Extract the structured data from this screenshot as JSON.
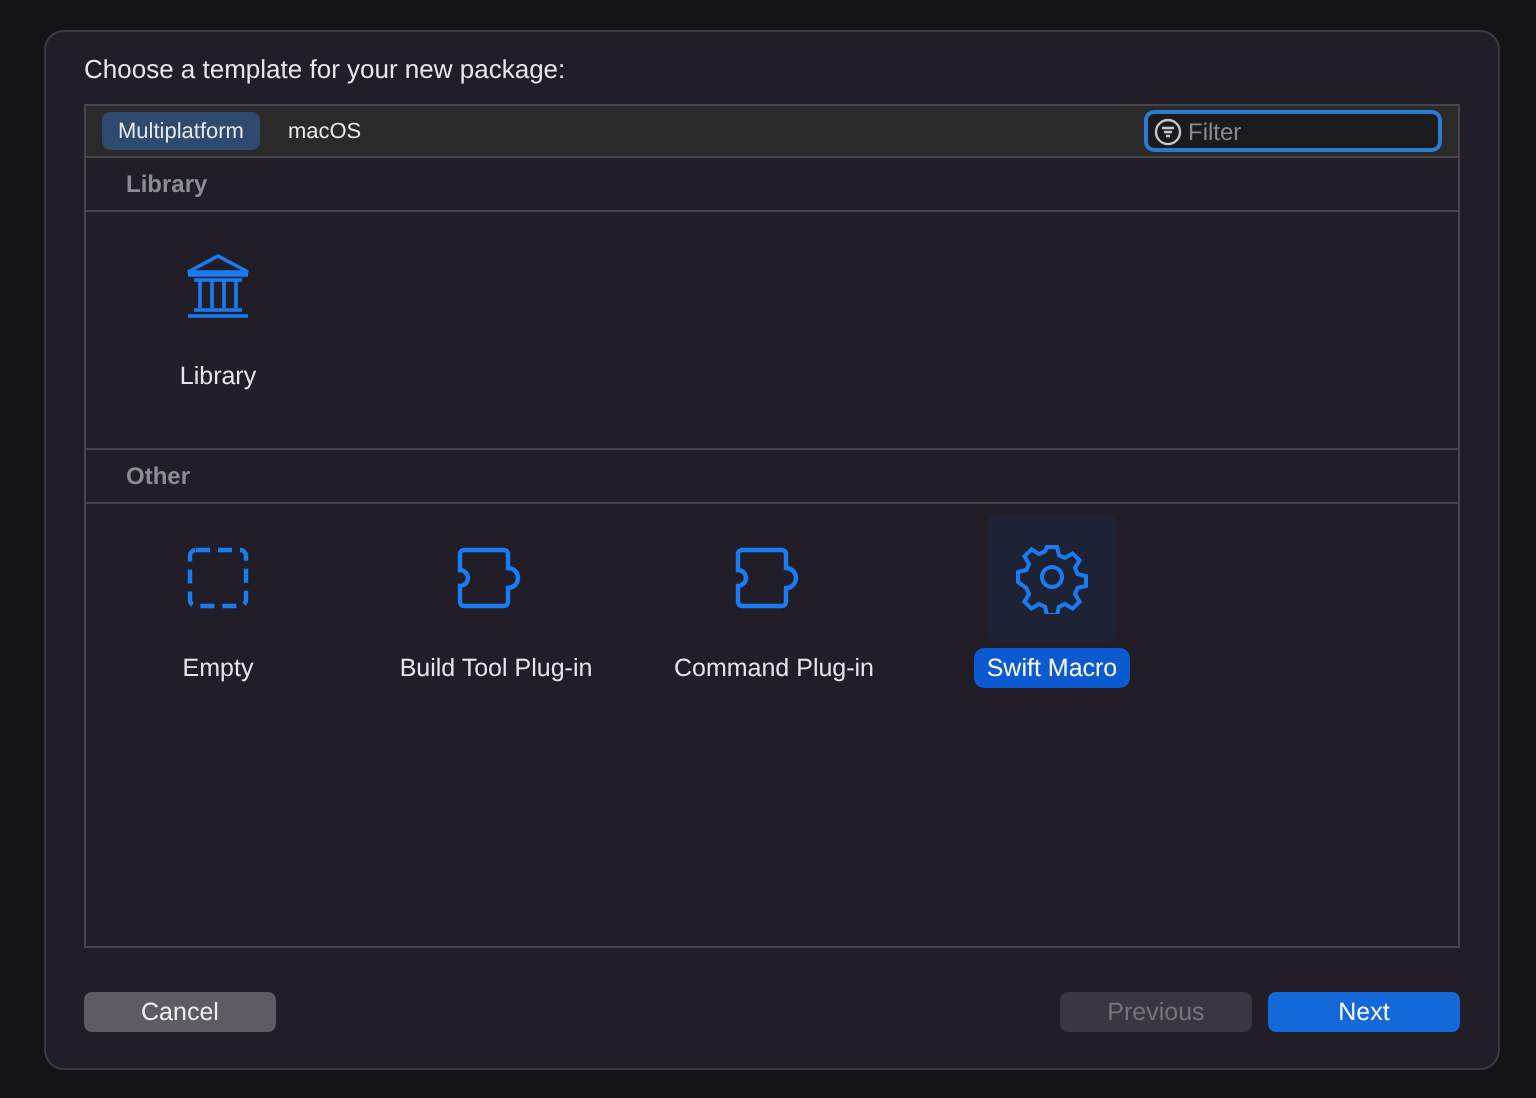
{
  "dialog": {
    "title": "Choose a template for your new package:"
  },
  "tabs": [
    {
      "label": "Multiplatform",
      "selected": true
    },
    {
      "label": "macOS",
      "selected": false
    }
  ],
  "filter": {
    "placeholder": "Filter"
  },
  "sections": [
    {
      "title": "Library",
      "items": [
        {
          "label": "Library",
          "kind": "library",
          "selected": false
        }
      ]
    },
    {
      "title": "Other",
      "items": [
        {
          "label": "Empty",
          "kind": "empty",
          "selected": false
        },
        {
          "label": "Build Tool Plug-in",
          "kind": "plugin",
          "selected": false
        },
        {
          "label": "Command Plug-in",
          "kind": "plugin",
          "selected": false
        },
        {
          "label": "Swift Macro",
          "kind": "macro",
          "selected": true
        }
      ]
    }
  ],
  "buttons": [
    {
      "label": "Cancel",
      "kind": "secondary",
      "disabled": false
    },
    {
      "label": "Previous",
      "kind": "secondary",
      "disabled": true
    },
    {
      "label": "Next",
      "kind": "primary",
      "disabled": false
    }
  ]
}
